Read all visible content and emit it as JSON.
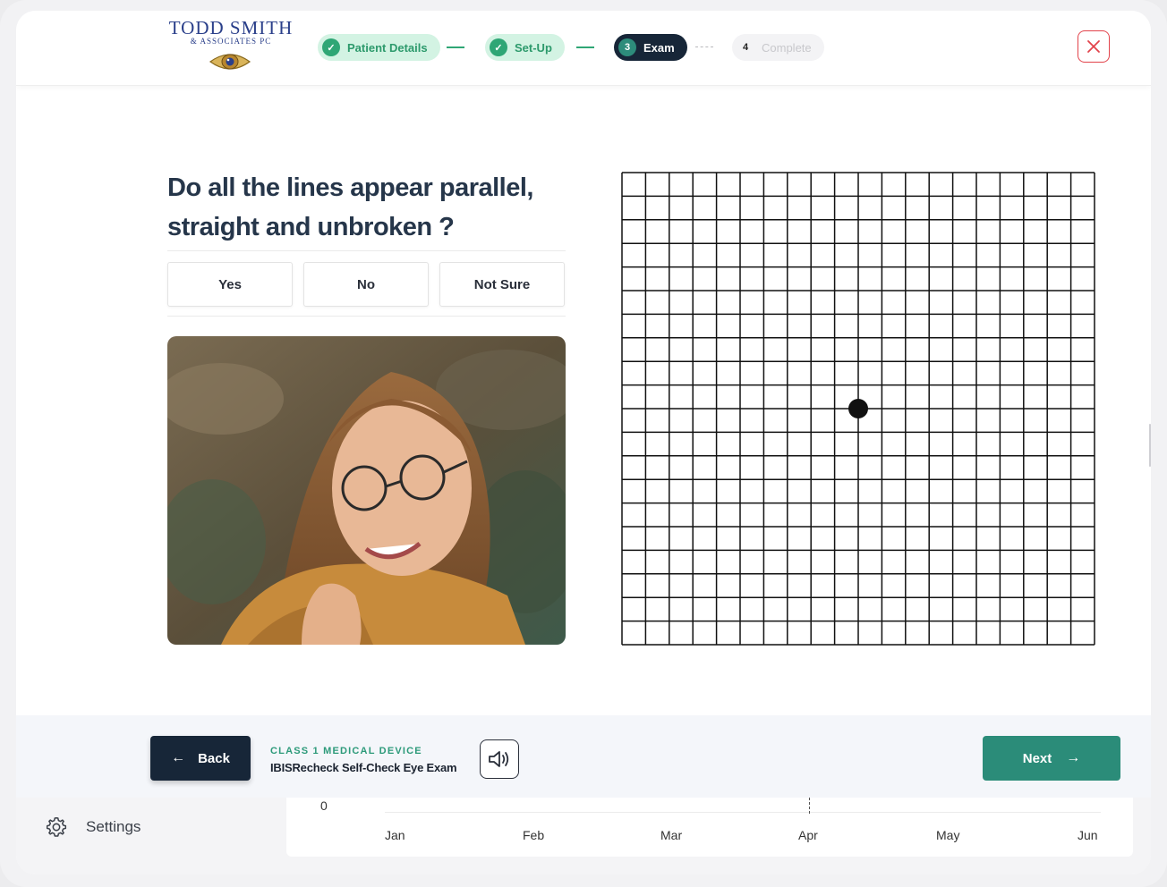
{
  "logo": {
    "name": "TODD SMITH",
    "subtitle": "& ASSOCIATES PC"
  },
  "steps": [
    {
      "label": "Patient Details",
      "state": "done"
    },
    {
      "label": "Set-Up",
      "state": "done"
    },
    {
      "number": "3",
      "label": "Exam",
      "state": "active"
    },
    {
      "number": "4",
      "label": "Complete",
      "state": "pending"
    }
  ],
  "question": {
    "text": "Do all the lines appear parallel, straight and unbroken ?"
  },
  "answers": [
    "Yes",
    "No",
    "Not Sure"
  ],
  "amsler_grid": {
    "cells": 20,
    "center_dot": true
  },
  "footer": {
    "back_label": "Back",
    "device_class": "CLASS 1 MEDICAL DEVICE",
    "device_name": "IBISRecheck Self-Check Eye Exam",
    "next_label": "Next"
  },
  "background_app": {
    "settings_label": "Settings",
    "chart_zero": "0",
    "months": [
      "Jan",
      "Feb",
      "Mar",
      "Apr",
      "May",
      "Jun"
    ]
  },
  "colors": {
    "navy": "#172638",
    "teal": "#2b8c79",
    "done_green": "#2fa675",
    "close_red": "#e2434b"
  }
}
